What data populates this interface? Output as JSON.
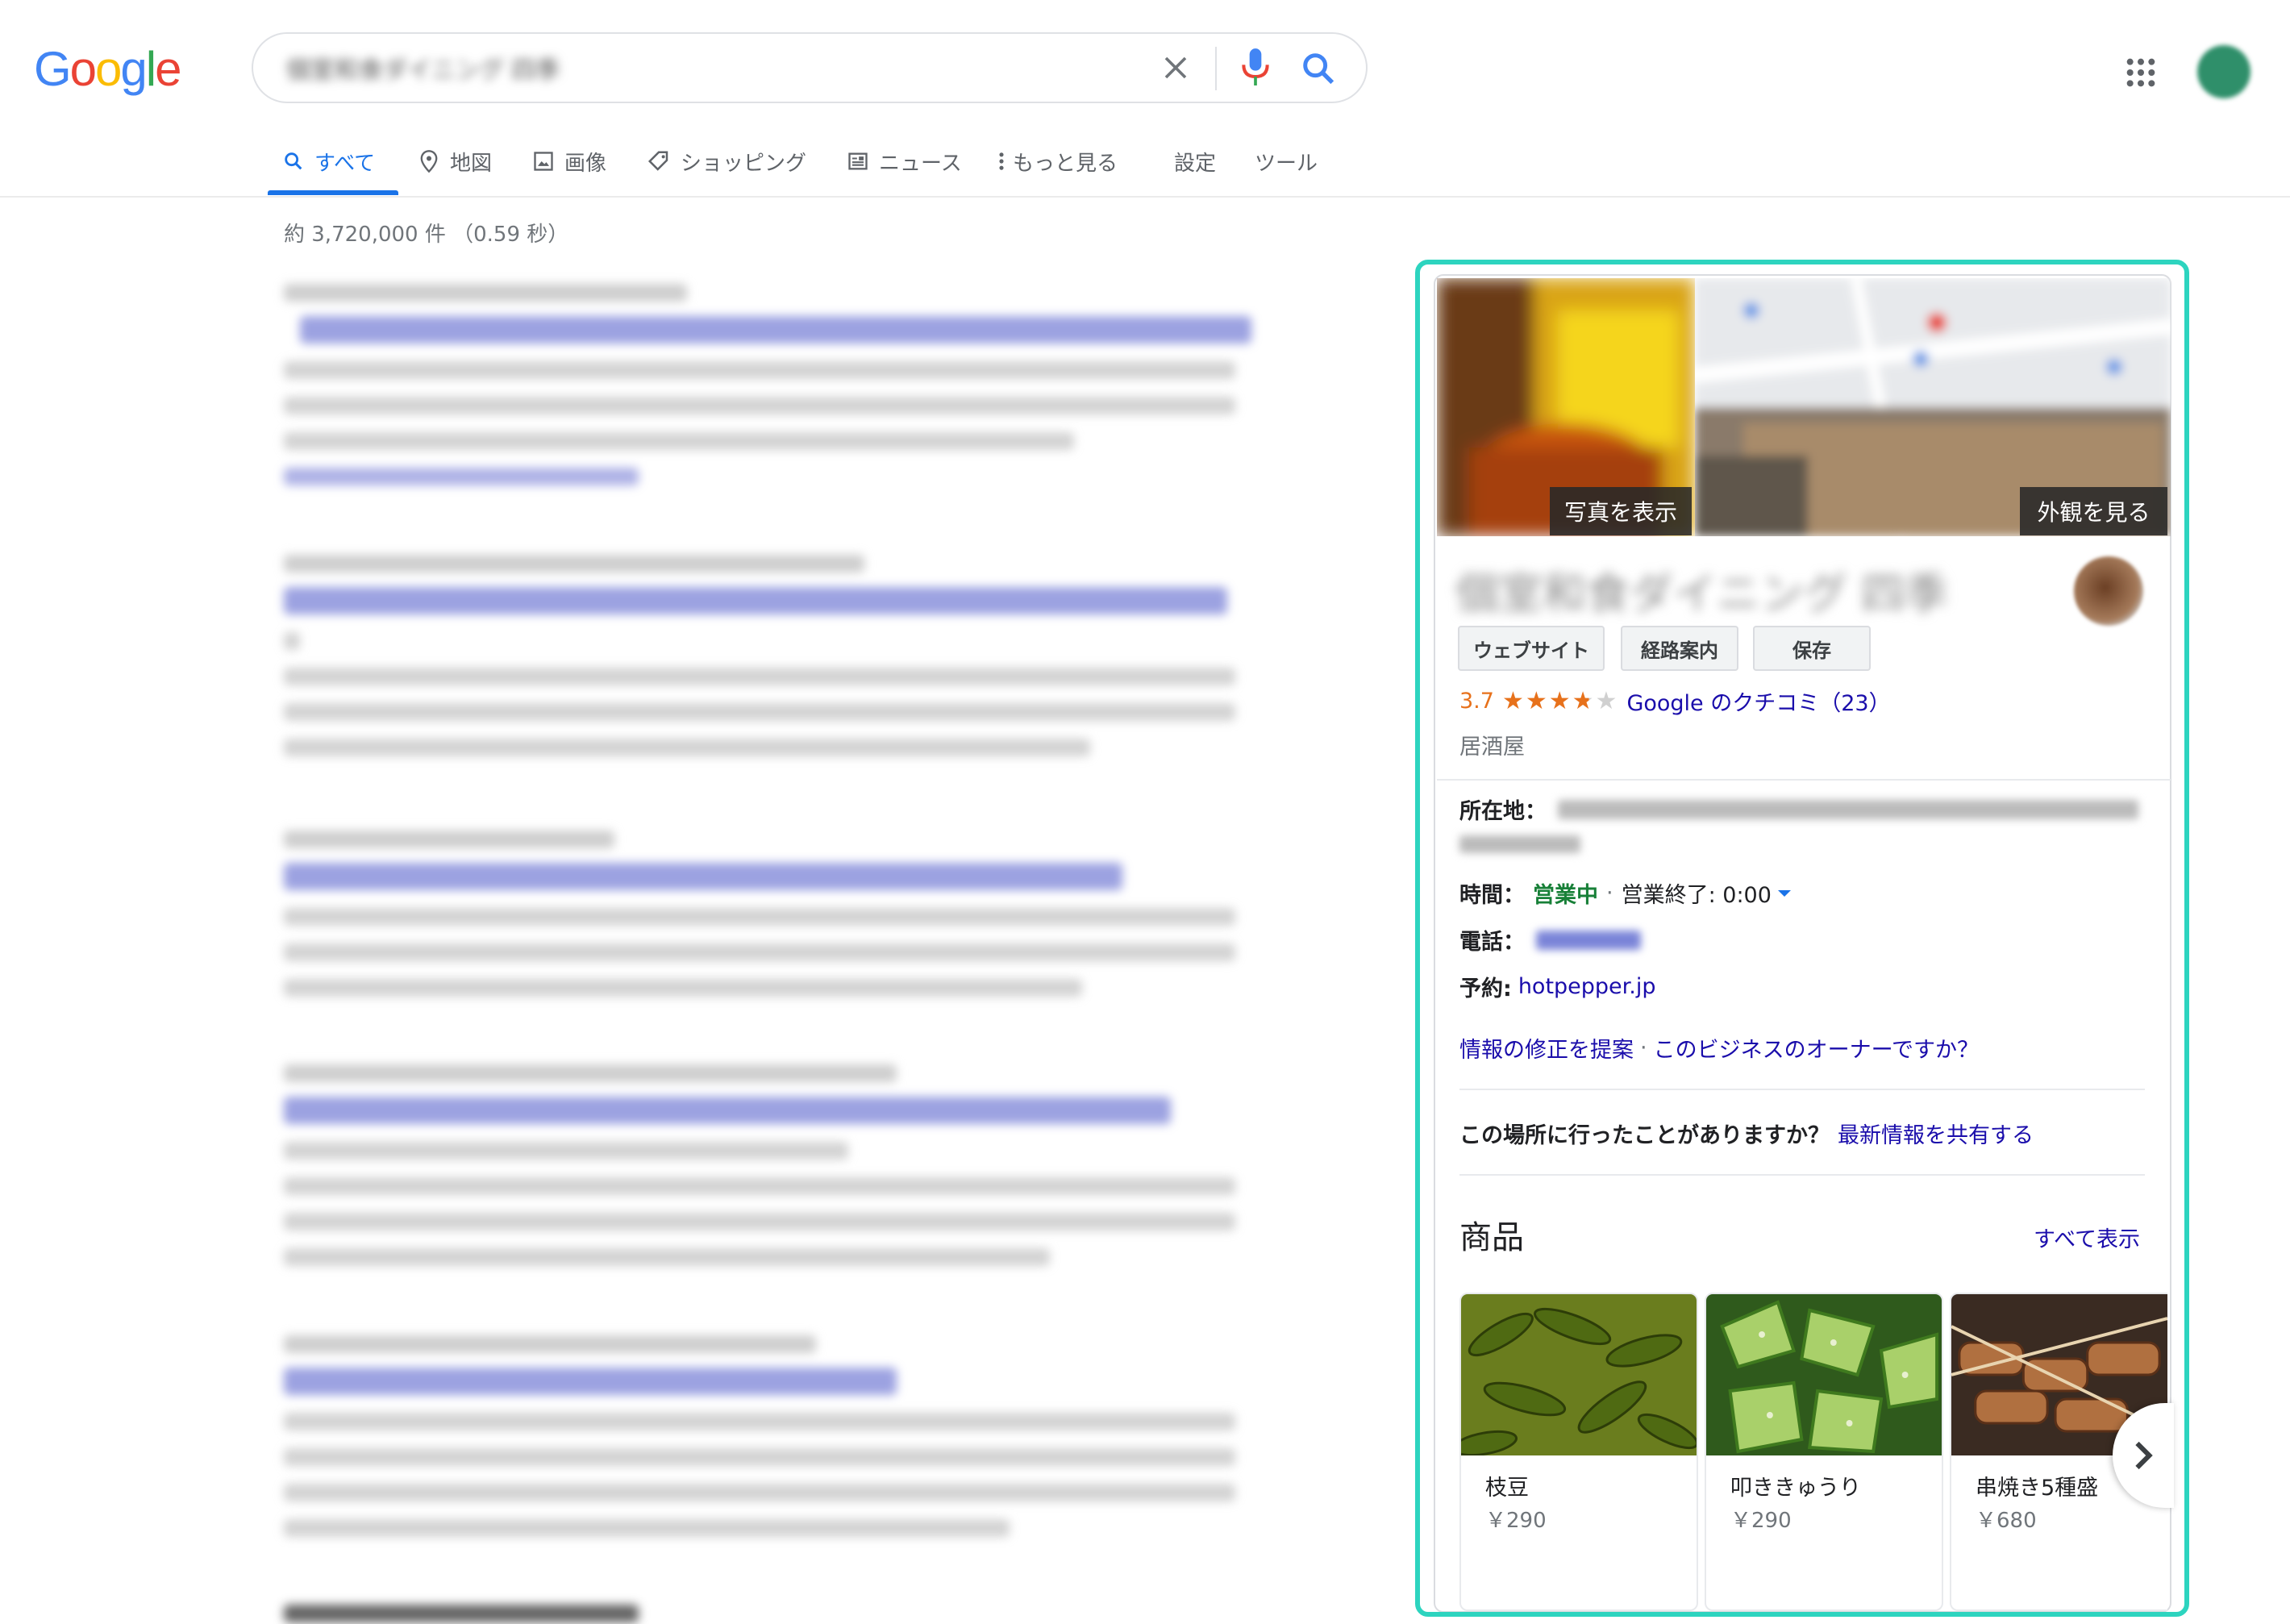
{
  "header": {
    "logo_text": "Google",
    "query_text": "個室和食ダイニング 四季",
    "apps_icon": "apps-grid-icon",
    "avatar_icon": "account-avatar"
  },
  "tabs": [
    {
      "label": "すべて",
      "icon": "search-icon"
    },
    {
      "label": "地図",
      "icon": "map-pin-icon"
    },
    {
      "label": "画像",
      "icon": "image-icon"
    },
    {
      "label": "ショッピング",
      "icon": "tag-icon"
    },
    {
      "label": "ニュース",
      "icon": "news-icon"
    },
    {
      "label": "もっと見る",
      "icon": "more-vert-icon"
    },
    {
      "label": "設定"
    },
    {
      "label": "ツール"
    }
  ],
  "stats": "約 3,720,000 件 （0.59 秒）",
  "knowledge_panel": {
    "photos_button": "写真を表示",
    "exterior_button": "外観を見る",
    "name": "個室和食ダイニング 四季",
    "actions": [
      "ウェブサイト",
      "経路案内",
      "保存"
    ],
    "rating": {
      "value": "3.7",
      "stars": 3.7,
      "reviews_text": "Google のクチコミ（23）"
    },
    "category": "居酒屋",
    "address": {
      "label": "所在地：",
      "value": "〒000-0000 住所"
    },
    "hours": {
      "label": "時間：",
      "status": "営業中",
      "separator": "·",
      "close": "営業終了: 0:00"
    },
    "phone": {
      "label": "電話：",
      "value": "00-0000-0000"
    },
    "reservation": {
      "label": "予約:",
      "value": "hotpepper.jp"
    },
    "suggest_edit": "情報の修正を提案",
    "dot": "·",
    "owner_link": "このビジネスのオーナーですか？",
    "visited_question": "この場所に行ったことがありますか？",
    "share_link": "最新情報を共有する",
    "products_title": "商品",
    "see_all": "すべて表示",
    "products": [
      {
        "name": "枝豆",
        "price": "￥290"
      },
      {
        "name": "叩ききゅうり",
        "price": "￥290"
      },
      {
        "name": "串焼き5種盛",
        "price": "￥680"
      }
    ]
  },
  "colors": {
    "accent": "#1a73e8",
    "highlight": "#2dd4bf",
    "open": "#188038",
    "stars": "#e7711b",
    "link": "#1a0dab"
  }
}
